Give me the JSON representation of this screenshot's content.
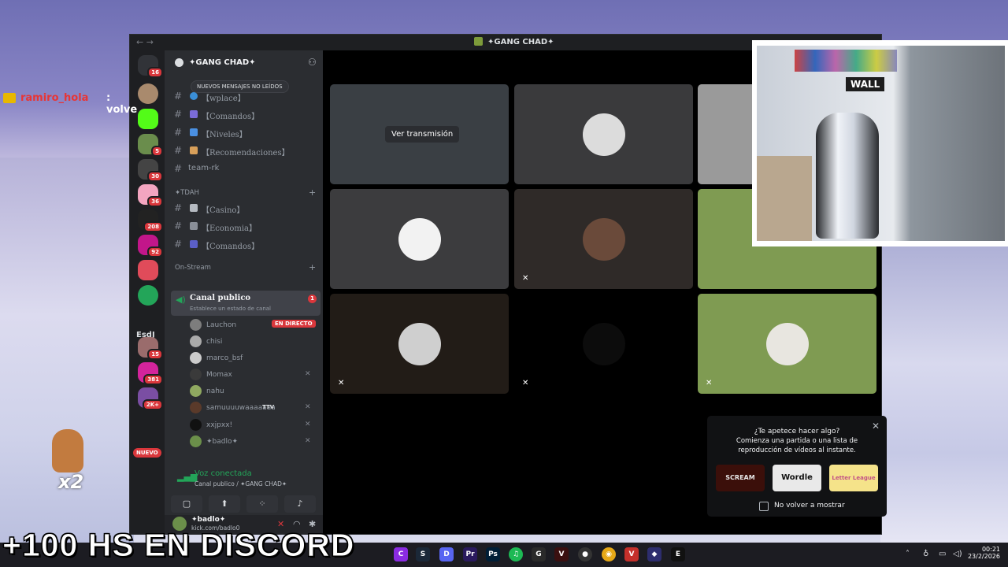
{
  "stream_overlay": {
    "chat_username": "ramiro_hola",
    "chat_message": ": volve",
    "multiplier": "x2",
    "caption": "+100 HS EN DISCORD"
  },
  "window": {
    "title": "✦GANG CHAD✦"
  },
  "guilds": {
    "badges": [
      "16",
      "5",
      "30",
      "36",
      "208",
      "92",
      "15",
      "381",
      "2K+"
    ],
    "esdj_label": "EsdJ",
    "new_label": "NUEVO"
  },
  "sidebar": {
    "server_name": "✦GANG CHAD✦",
    "unread_pill": "NUEVOS MENSAJES NO LEÍDOS",
    "channels_top": [
      {
        "label": "【wplace】"
      },
      {
        "label": "【Comandos】"
      },
      {
        "label": "【Niveles】"
      },
      {
        "label": "【Recomendaciones】"
      },
      {
        "label": "team-rk"
      }
    ],
    "category_tdah": "✦TDAH",
    "channels_tdah": [
      {
        "label": "【Casino】"
      },
      {
        "label": "【Economia】"
      },
      {
        "label": "【Comandos】"
      }
    ],
    "category_onstream": "On-Stream",
    "voice_channel": {
      "name": "Canal publico",
      "status": "Establece un estado de canal",
      "count": "1"
    },
    "voice_users": [
      {
        "name": "Lauchon",
        "tag": "EN DIRECTO"
      },
      {
        "name": "chisi"
      },
      {
        "name": "marco_bsf"
      },
      {
        "name": "Momax"
      },
      {
        "name": "nahu"
      },
      {
        "name": "samuuuuwaaaaaaa",
        "tag": "TTV"
      },
      {
        "name": "xxjpxx!"
      },
      {
        "name": "✦badlo✦"
      }
    ],
    "voice_panel": {
      "status": "Voz conectada",
      "location": "Canal publico / ✦GANG CHAD✦"
    },
    "user": {
      "name": "✦badlo✦",
      "status": "kick.com/badlo0"
    }
  },
  "stage": {
    "watch_label": "Ver transmisión"
  },
  "activity_popup": {
    "line1": "¿Te apetece hacer algo?",
    "line2": "Comienza una partida o una lista de",
    "line3": "reproducción de vídeos al instante.",
    "games": [
      "SCREAM",
      "Wordle",
      "Letter League"
    ],
    "checkbox_label": "No volver a mostrar"
  },
  "webcam": {
    "sign": "WALL"
  },
  "taskbar": {
    "time": "00:21",
    "date": "23/2/2026"
  },
  "colors": {
    "discord_bg": "#1e1f22",
    "sidebar_bg": "#2b2d31",
    "live_red": "#da373c",
    "voice_green": "#23a559",
    "tile_green": "#7f9b52"
  }
}
